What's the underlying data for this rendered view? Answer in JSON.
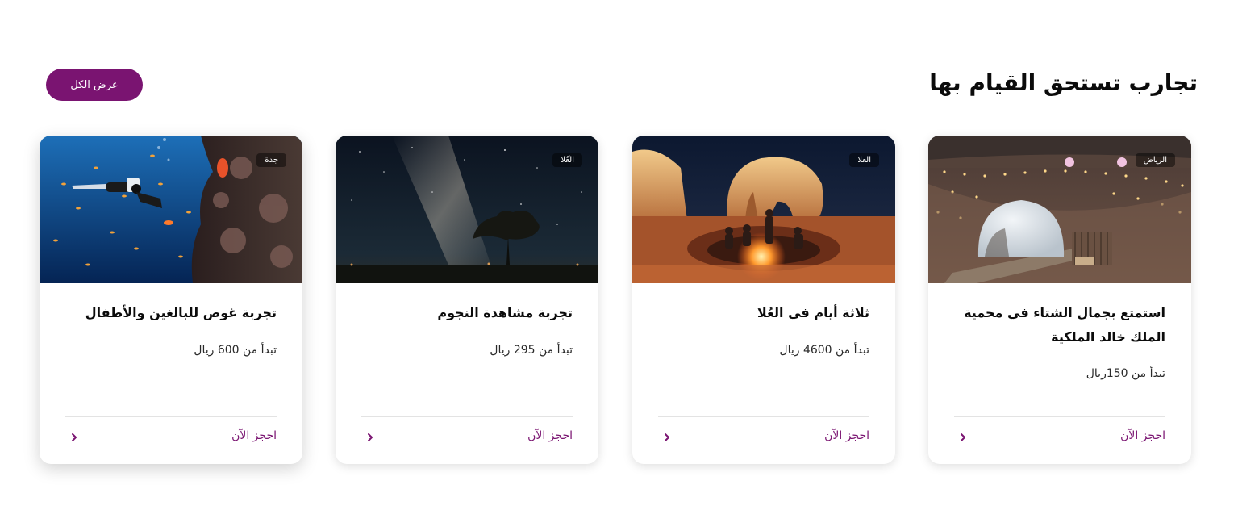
{
  "section": {
    "title": "تجارب تستحق القيام بها",
    "view_all_label": "عرض الكل"
  },
  "colors": {
    "accent": "#7a1471",
    "title_text": "#0b0b0b",
    "divider": "#e3e3e3"
  },
  "cards": [
    {
      "city": "الرياض",
      "title": "استمتع بجمال الشتاء في محمية الملك خالد الملكية",
      "price": "تبدأ من 150ريال",
      "book_label": "احجز الآن",
      "image": "desert-dome-camp-image"
    },
    {
      "city": "العلا",
      "title": "ثلاثة أيام في العُلا",
      "price": "تبدأ من 4600 ريال",
      "book_label": "احجز الآن",
      "image": "elephant-rock-campfire-image"
    },
    {
      "city": "العُلا",
      "title": "تجربة مشاهدة النجوم",
      "price": "تبدأ من 295 ريال",
      "book_label": "احجز الآن",
      "image": "milky-way-stargazing-image"
    },
    {
      "city": "جدة",
      "title": "تجربة غوص للبالغين والأطفال",
      "price": "تبدأ من 600 ريال",
      "book_label": "احجز الآن",
      "image": "scuba-diving-reef-image"
    }
  ]
}
